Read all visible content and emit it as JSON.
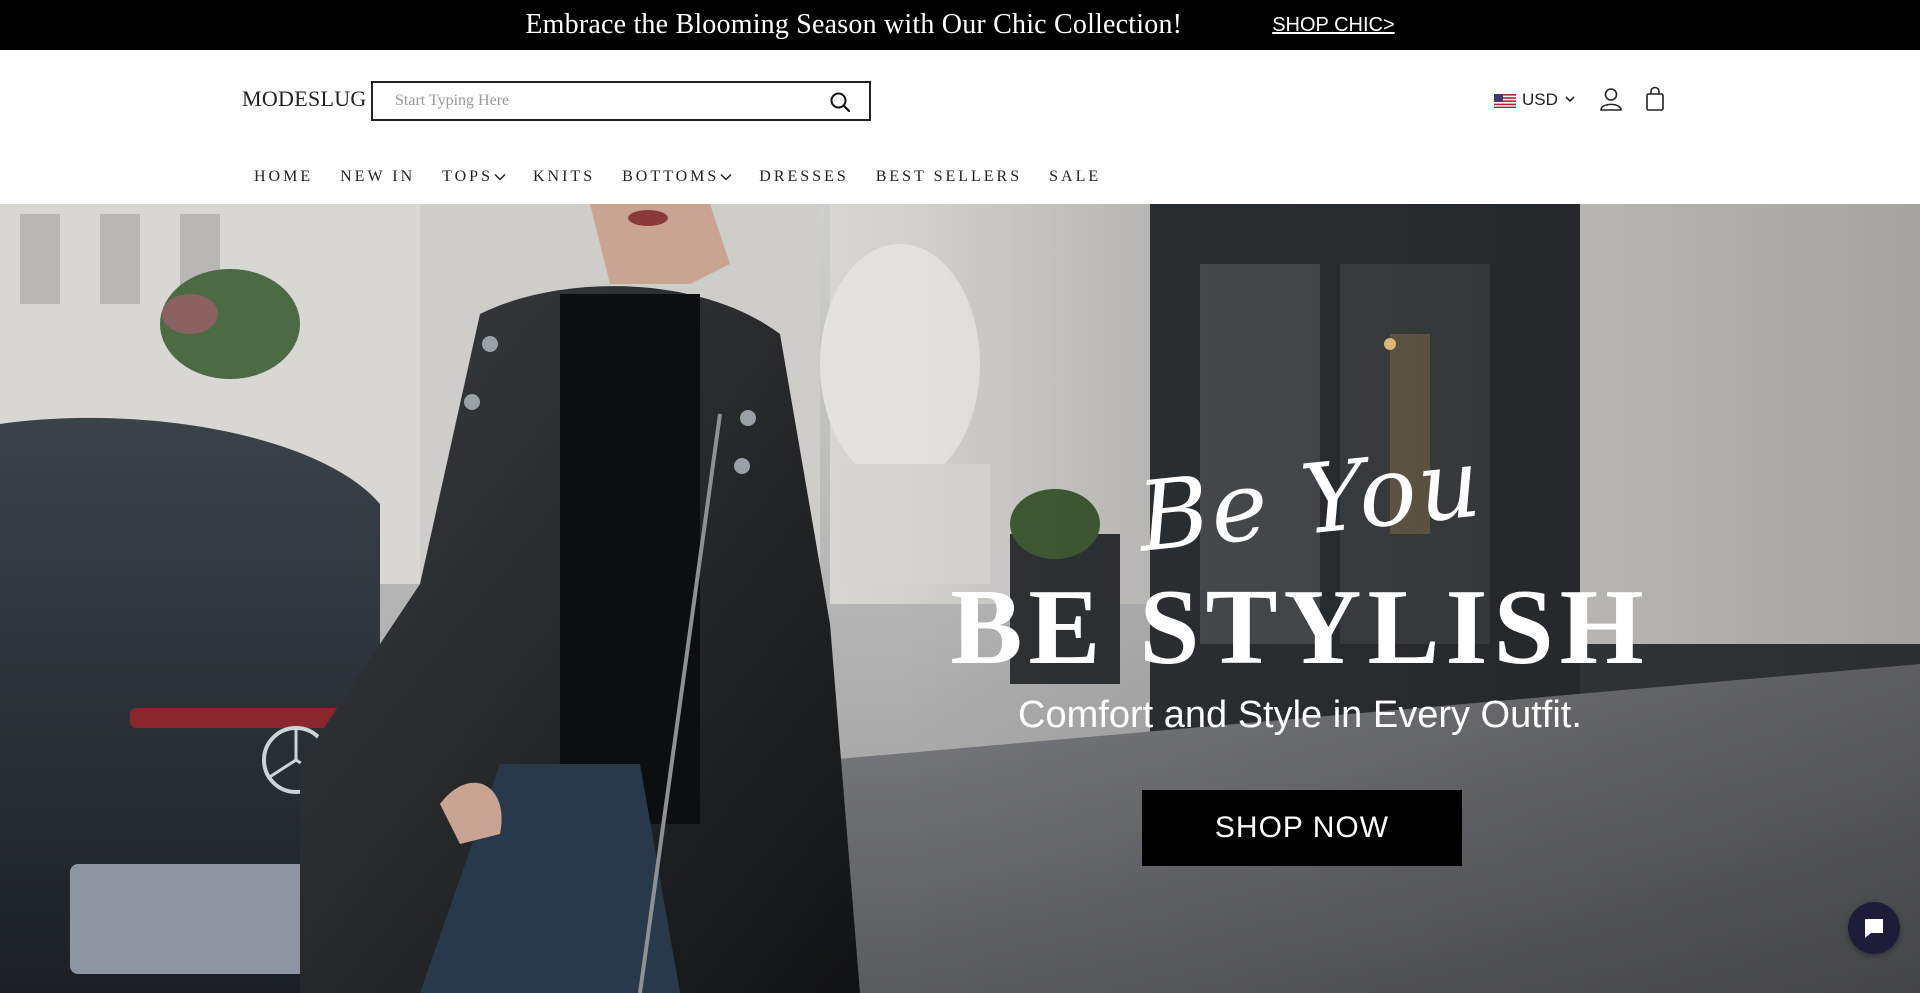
{
  "announcement": {
    "text": "Embrace the Blooming Season with Our Chic Collection!",
    "link": "SHOP CHIC>"
  },
  "header": {
    "logo": "MODESLUG",
    "search_placeholder": "Start Typing Here",
    "currency": "USD",
    "icons": [
      "search-icon",
      "us-flag-icon",
      "chevron-down-icon",
      "user-icon",
      "shopping-bag-icon"
    ]
  },
  "nav": {
    "items": [
      {
        "label": "HOME",
        "dropdown": false
      },
      {
        "label": "NEW IN",
        "dropdown": false
      },
      {
        "label": "TOPS",
        "dropdown": true
      },
      {
        "label": "KNITS",
        "dropdown": false
      },
      {
        "label": "BOTTOMS",
        "dropdown": true
      },
      {
        "label": "DRESSES",
        "dropdown": false
      },
      {
        "label": "BEST SELLERS",
        "dropdown": false
      },
      {
        "label": "SALE",
        "dropdown": false
      }
    ]
  },
  "hero": {
    "script": "Be You",
    "title": "BE STYLISH",
    "subtitle": "Comfort and Style in Every Outfit.",
    "button": "SHOP NOW"
  },
  "colors": {
    "announcement_bg": "#000000",
    "button_bg": "#000000",
    "chat_bg": "#1d1d3a"
  }
}
